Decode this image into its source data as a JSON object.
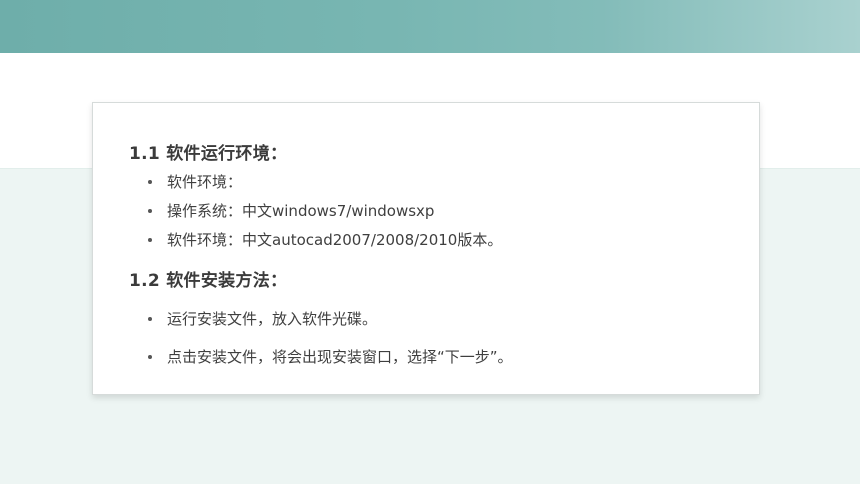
{
  "section1": {
    "heading": "1.1 软件运行环境：",
    "items": [
      "软件环境：",
      "操作系统：中文windows7/windowsxp",
      "软件环境：中文autocad2007/2008/2010版本。"
    ]
  },
  "section2": {
    "heading": "1.2 软件安装方法：",
    "items": [
      "运行安装文件，放入软件光碟。",
      "点击安装文件，将会出现安装窗口，选择“下一步”。"
    ]
  },
  "colors": {
    "banner": "#78b6b2",
    "panel": "#edf5f3",
    "text": "#3f3f3f"
  }
}
